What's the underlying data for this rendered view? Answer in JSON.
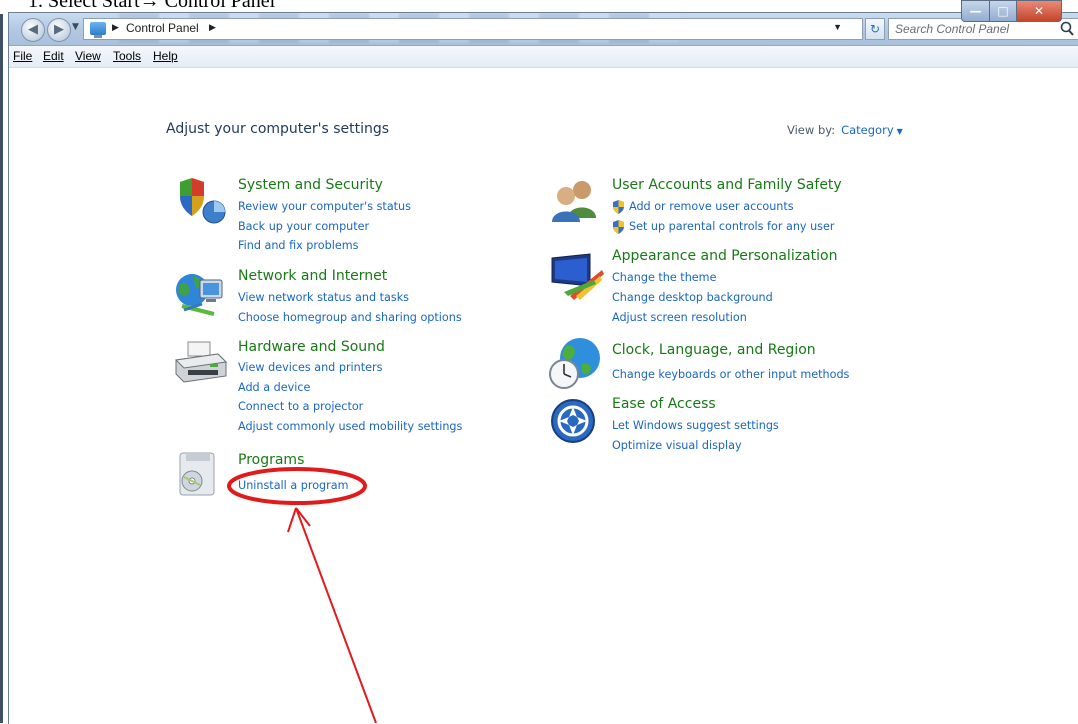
{
  "caption": "1.   Select Start→ Control Panel",
  "window": {
    "address_path": "Control Panel",
    "search_placeholder": "Search Control Panel",
    "controls": {
      "minimize": "—",
      "maximize": "□",
      "close": "✕"
    }
  },
  "menu": [
    "File",
    "Edit",
    "View",
    "Tools",
    "Help"
  ],
  "page_title": "Adjust your computer's settings",
  "view_by": {
    "label": "View by:",
    "value": "Category"
  },
  "categories_left": [
    {
      "title": "System and Security",
      "icon": "shield-icon",
      "links": [
        "Review your computer's status",
        "Back up your computer",
        "Find and fix problems"
      ]
    },
    {
      "title": "Network and Internet",
      "icon": "globe-network-icon",
      "links": [
        "View network status and tasks",
        "Choose homegroup and sharing options"
      ]
    },
    {
      "title": "Hardware and Sound",
      "icon": "printer-icon",
      "links": [
        "View devices and printers",
        "Add a device",
        "Connect to a projector",
        "Adjust commonly used mobility settings"
      ]
    },
    {
      "title": "Programs",
      "icon": "programs-icon",
      "links": [
        "Uninstall a program"
      ]
    }
  ],
  "categories_right": [
    {
      "title": "User Accounts and Family Safety",
      "icon": "users-icon",
      "links": [
        "Add or remove user accounts",
        "Set up parental controls for any user"
      ]
    },
    {
      "title": "Appearance and Personalization",
      "icon": "monitor-paint-icon",
      "links": [
        "Change the theme",
        "Change desktop background",
        "Adjust screen resolution"
      ]
    },
    {
      "title": "Clock, Language, and Region",
      "icon": "clock-globe-icon",
      "links": [
        "Change keyboards or other input methods"
      ]
    },
    {
      "title": "Ease of Access",
      "icon": "ease-of-access-icon",
      "links": [
        "Let Windows suggest settings",
        "Optimize visual display"
      ]
    }
  ],
  "colors": {
    "title_green": "#187a16",
    "link_blue": "#1a66c2",
    "annotation_red": "#e11b1b"
  }
}
